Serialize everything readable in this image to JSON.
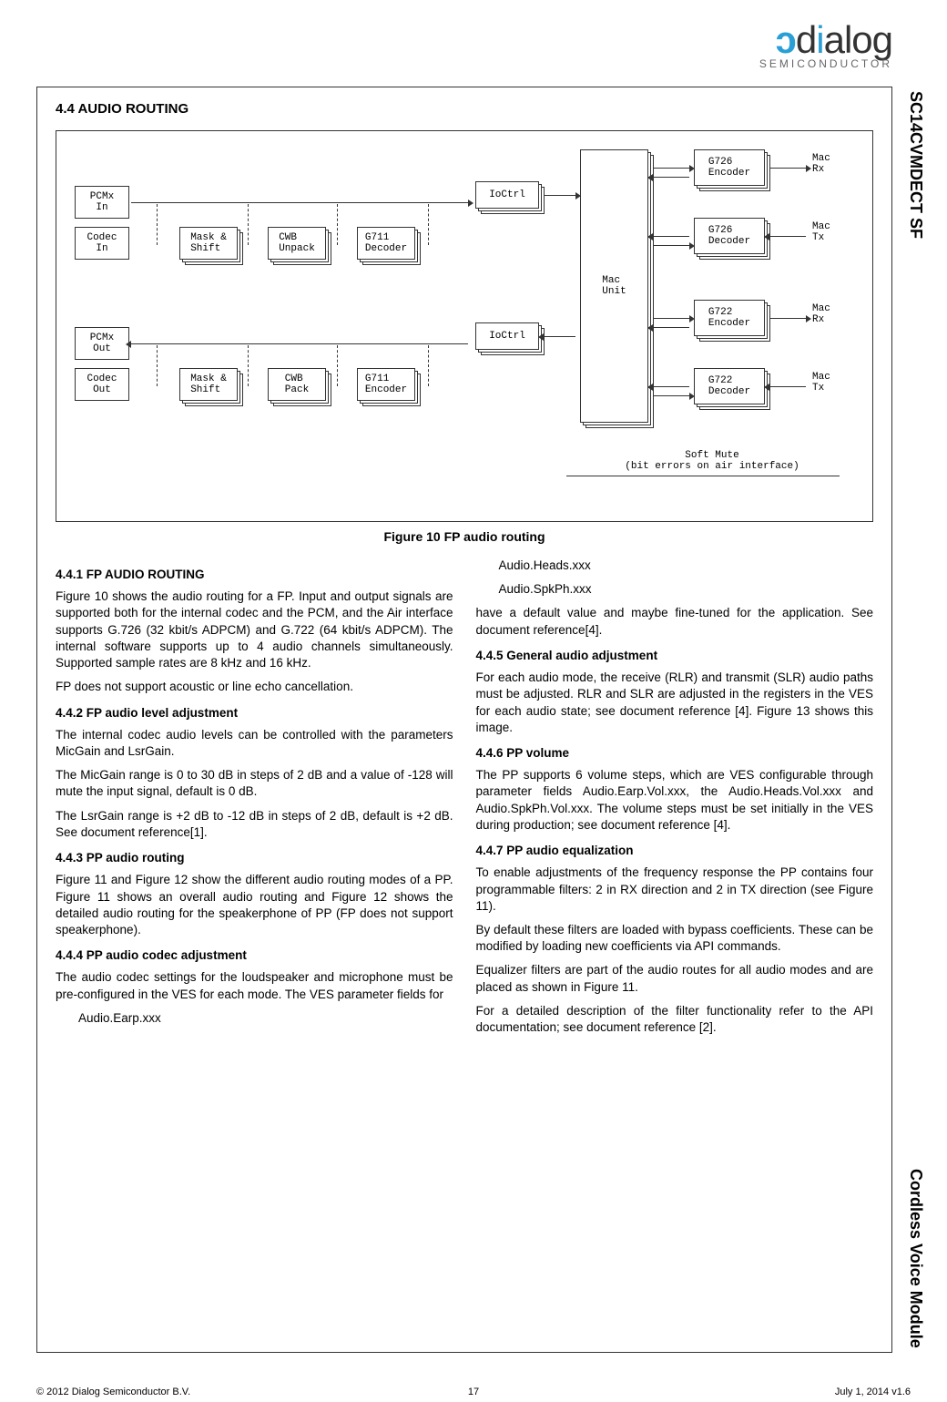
{
  "logo": {
    "brand": "dialog",
    "sub": "SEMICONDUCTOR"
  },
  "sidebar": {
    "top": "SC14CVMDECT SF",
    "bottom": "Cordless Voice Module"
  },
  "section": {
    "num_title": "4.4  AUDIO ROUTING"
  },
  "diagram": {
    "pcmx_in": "PCMx\nIn",
    "codec_in": "Codec\nIn",
    "pcmx_out": "PCMx\nOut",
    "codec_out": "Codec\nOut",
    "mask_shift": "Mask &\nShift",
    "cwb_unpack": "CWB\nUnpack",
    "cwb_pack": "CWB\nPack",
    "g711_dec": "G711\nDecoder",
    "g711_enc": "G711\nEncoder",
    "ioctrl": "IoCtrl",
    "mac_unit": "Mac\nUnit",
    "g726_enc": "G726\nEncoder",
    "g726_dec": "G726\nDecoder",
    "g722_enc": "G722\nEncoder",
    "g722_dec": "G722\nDecoder",
    "mac_rx": "Mac\nRx",
    "mac_tx": "Mac\nTx",
    "soft_mute": "Soft Mute\n(bit errors on air interface)"
  },
  "figure_caption": "Figure 10  FP audio routing",
  "body": {
    "h441": "4.4.1 FP AUDIO ROUTING",
    "p441": "Figure 10 shows the audio routing for a FP. Input and output signals are supported both for the internal codec and the PCM, and the Air interface supports G.726 (32 kbit/s ADPCM) and G.722 (64 kbit/s ADPCM). The internal software supports up to 4 audio channels simultaneously. Supported sample rates are 8 kHz and 16 kHz.",
    "p441b": "FP does not support acoustic or line echo cancellation.",
    "h442": "4.4.2 FP audio level adjustment",
    "p442a": "The internal codec audio levels can be controlled with the parameters MicGain and LsrGain.",
    "p442b": "The MicGain range is 0 to 30 dB in steps of 2 dB and a value of -128 will mute the input signal, default is 0 dB.",
    "p442c": "The LsrGain range is +2 dB to -12 dB in steps of 2 dB, default is +2 dB. See document reference[1].",
    "h443": "4.4.3 PP audio routing",
    "p443": "Figure 11 and Figure 12 show the different audio routing modes of a PP. Figure 11 shows an overall audio routing and Figure 12 shows the detailed audio routing for the speakerphone of PP (FP does not support speakerphone).",
    "h444": "4.4.4 PP audio codec adjustment",
    "p444": "The audio codec settings for the loudspeaker and microphone must be pre-configured in the VES for each mode. The VES parameter fields for",
    "p444i1": "Audio.Earp.xxx",
    "p444i2": "Audio.Heads.xxx",
    "p444i3": "Audio.SpkPh.xxx",
    "p444b": "have a default value and maybe fine-tuned for the application. See document reference[4].",
    "h445": "4.4.5 General audio adjustment",
    "p445": "For each audio mode, the receive (RLR) and transmit (SLR) audio paths must be adjusted. RLR and SLR are adjusted in the registers in the VES for each audio state; see document reference [4]. Figure 13 shows this image.",
    "h446": "4.4.6 PP volume",
    "p446": "The PP supports 6 volume steps, which are VES configurable through parameter fields Audio.Earp.Vol.xxx, the Audio.Heads.Vol.xxx and Audio.SpkPh.Vol.xxx. The volume steps must be set initially in the VES during production; see document reference [4].",
    "h447": "4.4.7 PP audio equalization",
    "p447a": "To enable adjustments of the frequency response the PP contains four programmable filters: 2 in RX direction and 2 in TX direction (see Figure 11).",
    "p447b": "By default these filters are loaded with bypass coefficients. These can be modified by loading new coefficients via API commands.",
    "p447c": "Equalizer filters are part of the audio routes for all audio modes and are placed as shown in Figure 11.",
    "p447d": "For a detailed description of the filter functionality refer to the API documentation; see document reference [2]."
  },
  "footer": {
    "left": "© 2012 Dialog Semiconductor B.V.",
    "center": "17",
    "right": "July 1, 2014 v1.6"
  }
}
